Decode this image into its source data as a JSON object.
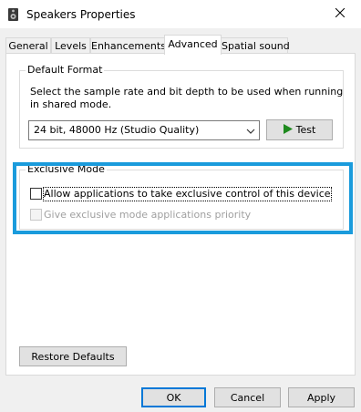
{
  "window": {
    "title": "Speakers Properties",
    "icon": "speaker-icon",
    "close_icon": "close-icon"
  },
  "tabs": [
    {
      "label": "General",
      "active": false
    },
    {
      "label": "Levels",
      "active": false
    },
    {
      "label": "Enhancements",
      "active": false
    },
    {
      "label": "Advanced",
      "active": true
    },
    {
      "label": "Spatial sound",
      "active": false
    }
  ],
  "default_format": {
    "group_label": "Default Format",
    "description_line1": "Select the sample rate and bit depth to be used when running",
    "description_line2": "in shared mode.",
    "selected_value": "24 bit, 48000 Hz (Studio Quality)",
    "test_button": "Test",
    "test_icon": "play-icon"
  },
  "exclusive_mode": {
    "group_label": "Exclusive Mode",
    "allow_label": "Allow applications to take exclusive control of this device",
    "allow_checked": false,
    "priority_label": "Give exclusive mode applications priority",
    "priority_checked": false,
    "priority_enabled": false
  },
  "footer": {
    "restore_label": "Restore Defaults",
    "ok_label": "OK",
    "cancel_label": "Cancel",
    "apply_label": "Apply"
  },
  "colors": {
    "highlight_border": "#1a9bdc",
    "default_button_border": "#0078d7",
    "play_green": "#1e8a1e"
  }
}
